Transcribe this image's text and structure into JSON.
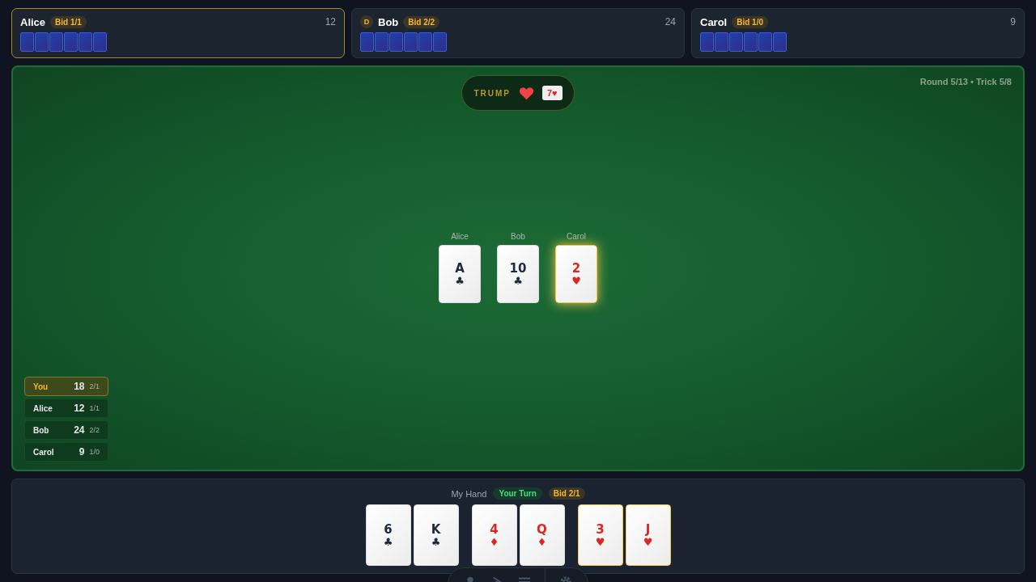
{
  "players": [
    {
      "name": "Alice",
      "bid": "Bid 1/1",
      "score": "12",
      "active": true,
      "cards": [
        {
          "kind": "back"
        },
        {
          "kind": "back"
        },
        {
          "kind": "back"
        },
        {
          "kind": "back"
        },
        {
          "kind": "back"
        },
        {
          "kind": "back"
        }
      ]
    },
    {
      "name": "Bob",
      "dealer_badge": "D",
      "bid": "Bid 2/2",
      "score": "24",
      "active": false,
      "cards": [
        {
          "kind": "back"
        },
        {
          "kind": "back"
        },
        {
          "kind": "back"
        },
        {
          "kind": "back"
        },
        {
          "kind": "back"
        },
        {
          "kind": "back"
        }
      ]
    },
    {
      "name": "Carol",
      "bid": "Bid 1/0",
      "score": "9",
      "active": false,
      "cards": [
        {
          "kind": "back"
        },
        {
          "kind": "back"
        },
        {
          "kind": "back"
        },
        {
          "kind": "back"
        },
        {
          "kind": "back"
        },
        {
          "kind": "back"
        }
      ]
    }
  ],
  "trump": {
    "label": "TRUMP",
    "card": "7♥"
  },
  "round_info": "Round 5/13 • Trick 5/8",
  "trick": [
    {
      "player": "Alice",
      "rank": "A",
      "suit": "♣",
      "color": "#1e293b",
      "winning": false
    },
    {
      "player": "Bob",
      "rank": "10",
      "suit": "♣",
      "color": "#1e293b",
      "winning": false
    },
    {
      "player": "Carol",
      "rank": "2",
      "suit": "♥",
      "color": "#dc2626",
      "winning": true
    }
  ],
  "scoreboard": [
    {
      "name": "You",
      "score": "18",
      "bid": "2/1",
      "current": true
    },
    {
      "name": "Alice",
      "score": "12",
      "bid": "1/1",
      "current": false
    },
    {
      "name": "Bob",
      "score": "24",
      "bid": "2/2",
      "current": false
    },
    {
      "name": "Carol",
      "score": "9",
      "bid": "1/0",
      "current": false
    }
  ],
  "hand": {
    "title": "My Hand",
    "turn": "Your Turn",
    "bid": "Bid 2/1",
    "groups": [
      [
        {
          "rank": "6",
          "suit": "♣",
          "color": "#1e293b",
          "playable": false
        },
        {
          "rank": "K",
          "suit": "♣",
          "color": "#1e293b",
          "playable": false
        }
      ],
      [
        {
          "rank": "4",
          "suit": "♦",
          "color": "#dc2626",
          "playable": false
        },
        {
          "rank": "Q",
          "suit": "♦",
          "color": "#dc2626",
          "playable": false
        }
      ],
      [
        {
          "rank": "3",
          "suit": "♥",
          "color": "#dc2626",
          "playable": true
        },
        {
          "rank": "J",
          "suit": "♥",
          "color": "#dc2626",
          "playable": true
        }
      ]
    ]
  }
}
